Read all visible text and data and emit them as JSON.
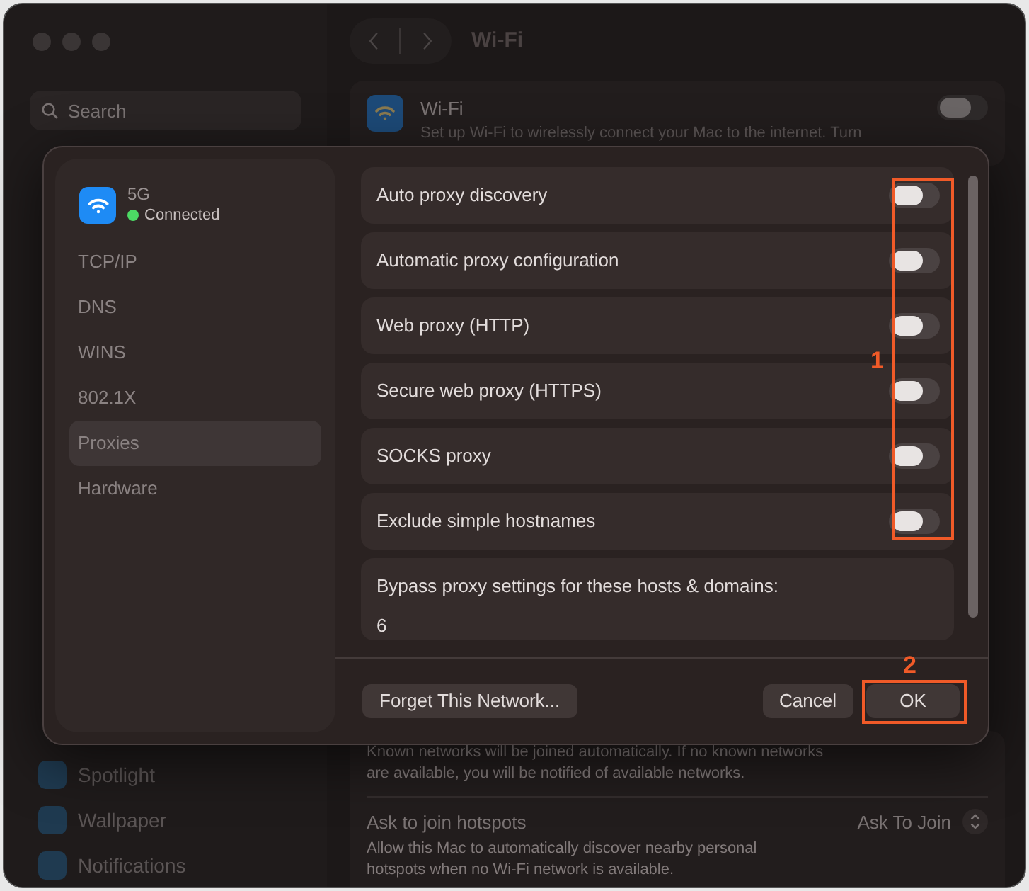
{
  "window": {
    "title": "Wi-Fi"
  },
  "sidebar": {
    "search": {
      "placeholder": "Search"
    },
    "items": [
      {
        "label": "Spotlight"
      },
      {
        "label": "Wallpaper"
      },
      {
        "label": "Notifications"
      }
    ]
  },
  "wifi_card": {
    "title": "Wi-Fi",
    "description": "Set up Wi-Fi to wirelessly connect your Mac to the internet. Turn",
    "on": false
  },
  "background_settings": {
    "known_networks_note": "Known networks will be joined automatically. If no known networks are available, you will be notified of available networks.",
    "hotspots": {
      "title": "Ask to join hotspots",
      "value": "Ask To Join",
      "description": "Allow this Mac to automatically discover nearby personal hotspots when no Wi-Fi network is available."
    }
  },
  "dialog": {
    "network": {
      "name": "5G",
      "status": "Connected"
    },
    "tabs": [
      {
        "label": "TCP/IP",
        "selected": false
      },
      {
        "label": "DNS",
        "selected": false
      },
      {
        "label": "WINS",
        "selected": false
      },
      {
        "label": "802.1X",
        "selected": false
      },
      {
        "label": "Proxies",
        "selected": true
      },
      {
        "label": "Hardware",
        "selected": false
      }
    ],
    "proxies": [
      {
        "label": "Auto proxy discovery",
        "on": false
      },
      {
        "label": "Automatic proxy configuration",
        "on": false
      },
      {
        "label": "Web proxy (HTTP)",
        "on": false
      },
      {
        "label": "Secure web proxy (HTTPS)",
        "on": false
      },
      {
        "label": "SOCKS proxy",
        "on": false
      },
      {
        "label": "Exclude simple hostnames",
        "on": false
      }
    ],
    "bypass": {
      "label": "Bypass proxy settings for these hosts & domains:",
      "value": "6"
    },
    "buttons": {
      "forget": "Forget This Network...",
      "cancel": "Cancel",
      "ok": "OK"
    }
  },
  "annotations": [
    {
      "label": "1"
    },
    {
      "label": "2"
    }
  ]
}
